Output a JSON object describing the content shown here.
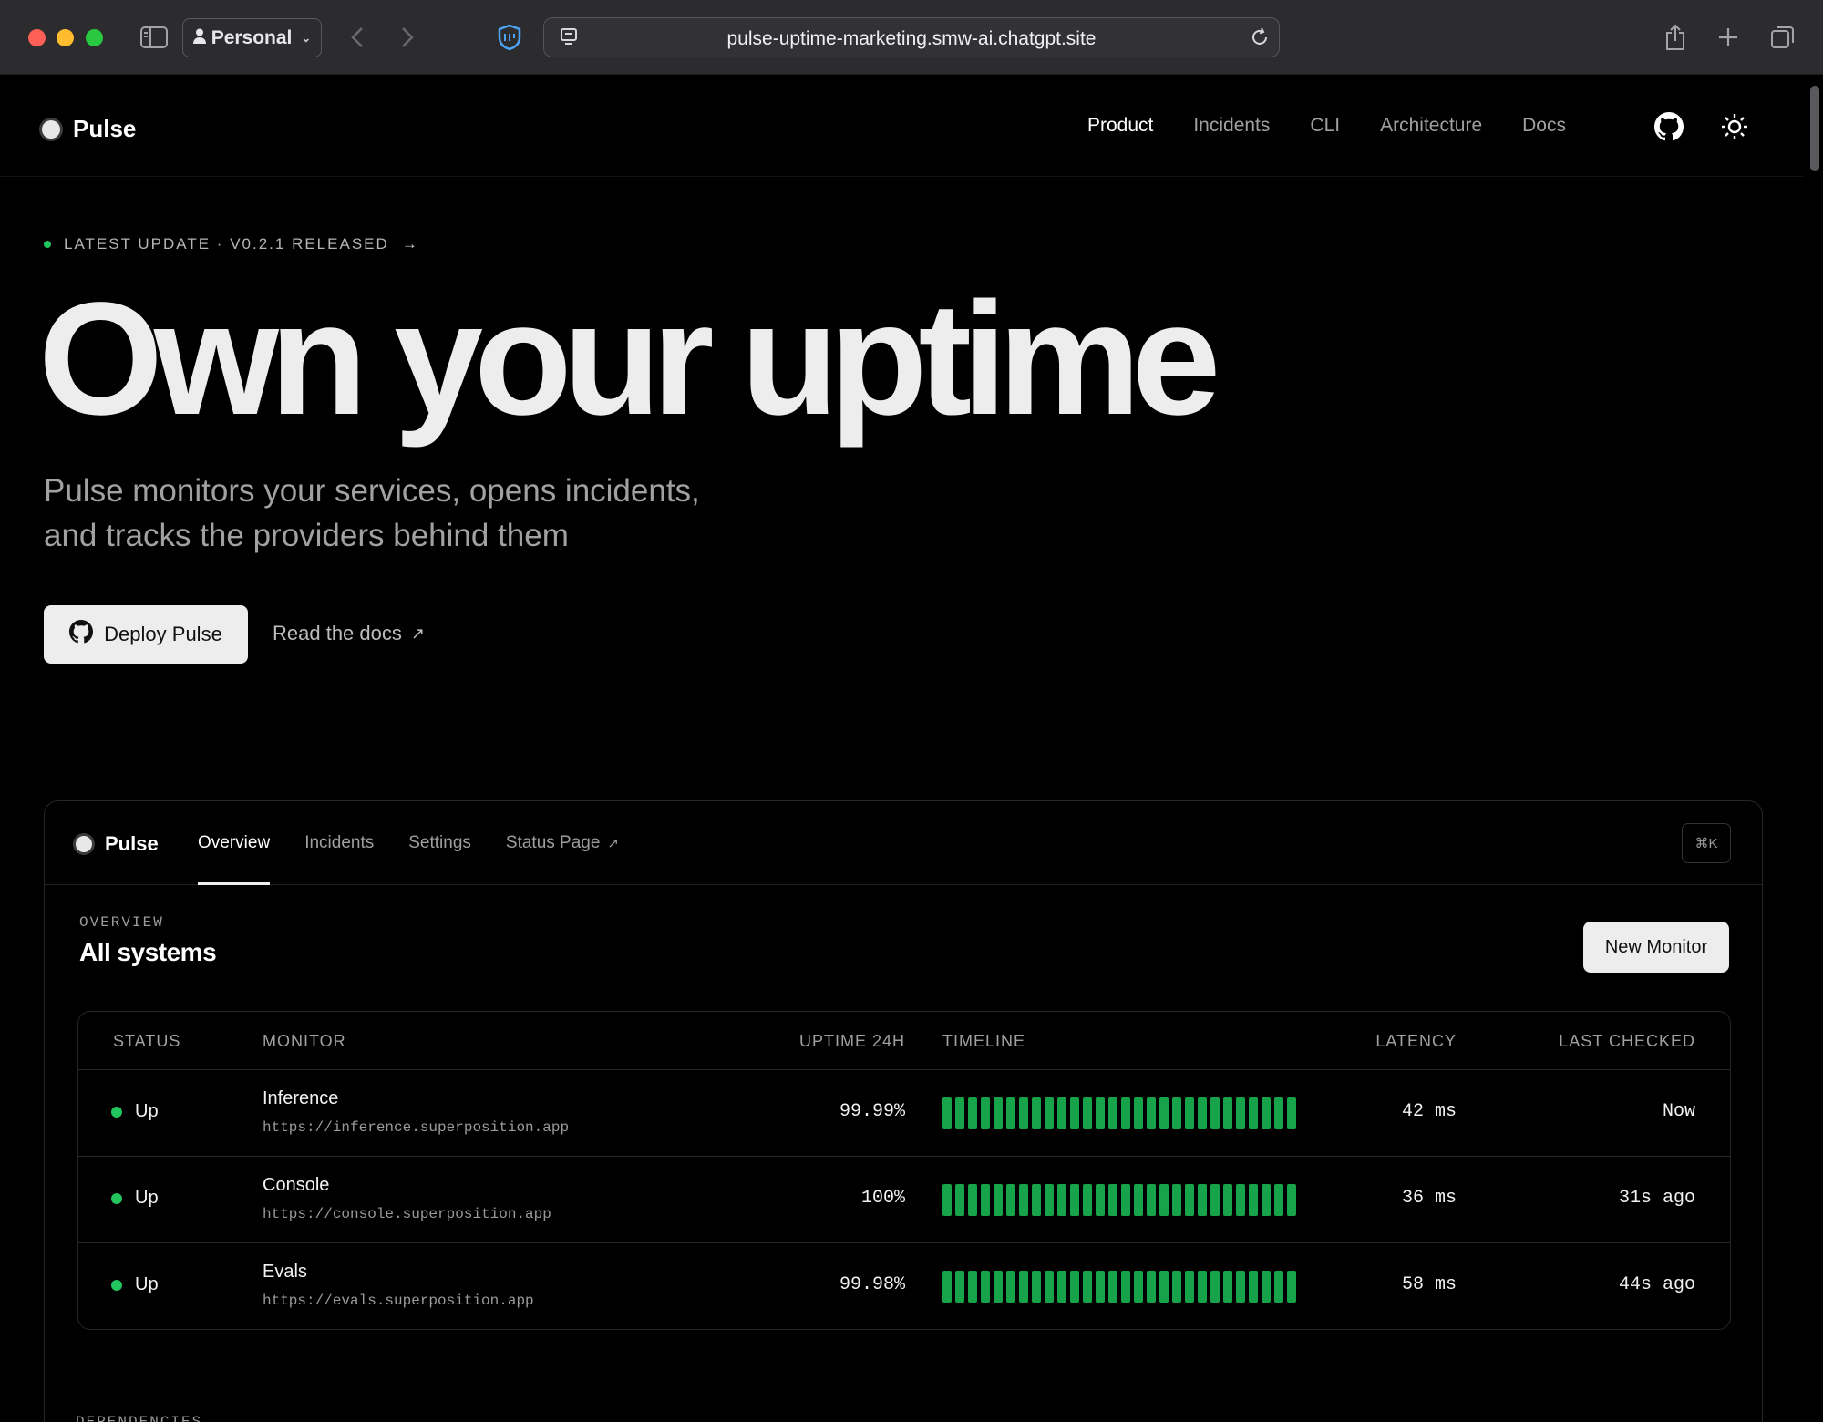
{
  "browser": {
    "profile_label": "Personal",
    "url": "pulse-uptime-marketing.smw-ai.chatgpt.site"
  },
  "site": {
    "brand": "Pulse",
    "nav": [
      "Product",
      "Incidents",
      "CLI",
      "Architecture",
      "Docs"
    ],
    "active_nav": "Product"
  },
  "hero": {
    "update_label": "LATEST UPDATE · V0.2.1 RELEASED",
    "update_arrow": "→",
    "title": "Own your uptime",
    "subtitle_line1": "Pulse monitors your services, opens incidents,",
    "subtitle_line2": "and tracks the providers behind them",
    "deploy_label": "Deploy Pulse",
    "docs_label": "Read the docs",
    "docs_arrow": "↗"
  },
  "dashboard": {
    "brand": "Pulse",
    "tabs": [
      "Overview",
      "Incidents",
      "Settings",
      "Status Page"
    ],
    "status_page_arrow": "↗",
    "shortcut": "⌘K",
    "section_label": "OVERVIEW",
    "section_title": "All systems",
    "new_monitor_label": "New Monitor",
    "columns": {
      "status": "STATUS",
      "monitor": "MONITOR",
      "uptime": "UPTIME 24H",
      "timeline": "TIMELINE",
      "latency": "LATENCY",
      "last_checked": "LAST CHECKED"
    },
    "rows": [
      {
        "status": "Up",
        "name": "Inference",
        "url": "https://inference.superposition.app",
        "uptime": "99.99%",
        "latency": "42 ms",
        "last_checked": "Now",
        "timeline_segments": 28,
        "timeline_status": "up"
      },
      {
        "status": "Up",
        "name": "Console",
        "url": "https://console.superposition.app",
        "uptime": "100%",
        "latency": "36 ms",
        "last_checked": "31s ago",
        "timeline_segments": 28,
        "timeline_status": "up"
      },
      {
        "status": "Up",
        "name": "Evals",
        "url": "https://evals.superposition.app",
        "uptime": "99.98%",
        "latency": "58 ms",
        "last_checked": "44s ago",
        "timeline_segments": 28,
        "timeline_status": "up"
      }
    ],
    "dependencies_label": "DEPENDENCIES"
  },
  "colors": {
    "status_up": "#22c55e",
    "timeline_up": "#16a34a",
    "background": "#000000"
  },
  "icons": [
    "sidebar-toggle-icon",
    "person-icon",
    "chevron-down-icon",
    "back-arrow-icon",
    "forward-arrow-icon",
    "shield-icon",
    "site-settings-icon",
    "reload-icon",
    "share-icon",
    "plus-icon",
    "tab-overview-icon",
    "github-icon",
    "sun-icon"
  ]
}
